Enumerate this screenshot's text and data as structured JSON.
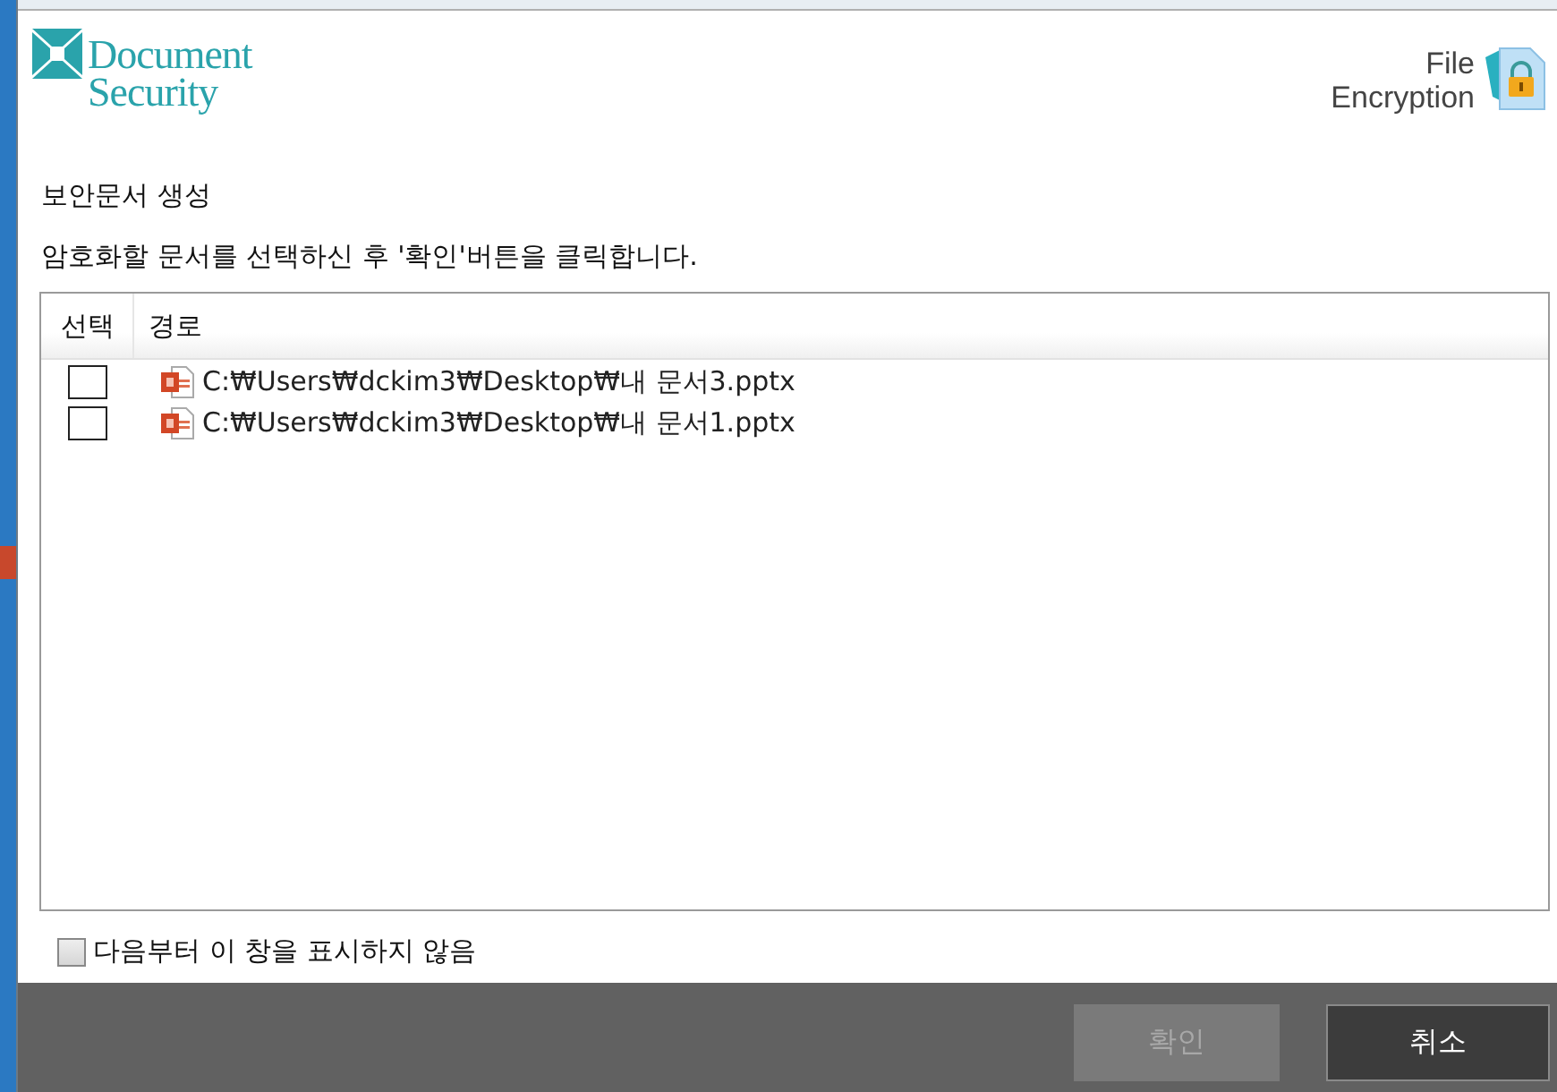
{
  "header": {
    "brand_lines": [
      "Document",
      "Security"
    ],
    "product_lines": [
      "File",
      "Encryption"
    ]
  },
  "title": "보안문서 생성",
  "instruction": "암호화할 문서를 선택하신 후 '확인'버튼을 클릭합니다.",
  "table": {
    "columns": [
      "선택",
      "경로"
    ],
    "rows": [
      {
        "path": "C:₩Users₩dckim3₩Desktop₩내 문서3.pptx",
        "checked": false
      },
      {
        "path": "C:₩Users₩dckim3₩Desktop₩내 문서1.pptx",
        "checked": false
      }
    ]
  },
  "dont_show_again": {
    "label": "다음부터 이 창을 표시하지 않음",
    "checked": false
  },
  "buttons": [
    {
      "label": "확인",
      "disabled": true
    },
    {
      "label": "취소",
      "disabled": false
    }
  ]
}
